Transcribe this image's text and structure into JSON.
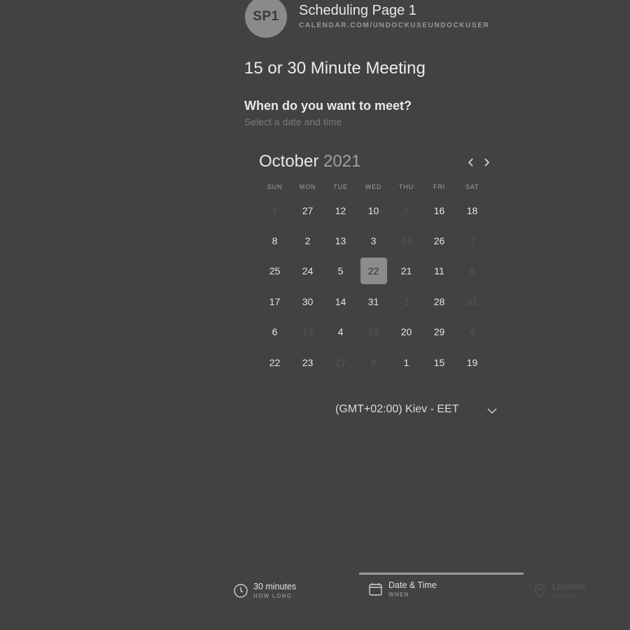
{
  "profile": {
    "initials": "SP1",
    "page_name": "Scheduling Page 1",
    "url": "CALENDAR.COM/UNDOCKUSEUNDOCKUSER"
  },
  "meeting": {
    "title": "15 or 30 Minute Meeting"
  },
  "prompt": {
    "title": "When do you want to meet?",
    "subtitle": "Select a date and time"
  },
  "calendar": {
    "month": "October",
    "year": "2021",
    "weekdays": [
      "SUN",
      "MON",
      "TUE",
      "WED",
      "THU",
      "FRI",
      "SAT"
    ],
    "weeks": [
      [
        {
          "d": "7",
          "off": true
        },
        {
          "d": "27"
        },
        {
          "d": "12"
        },
        {
          "d": "10"
        },
        {
          "d": "7",
          "off": true
        },
        {
          "d": "16"
        },
        {
          "d": "18"
        }
      ],
      [
        {
          "d": "8"
        },
        {
          "d": "2"
        },
        {
          "d": "13"
        },
        {
          "d": "3"
        },
        {
          "d": "14",
          "off": true
        },
        {
          "d": "26"
        },
        {
          "d": "7",
          "off": true
        }
      ],
      [
        {
          "d": "25"
        },
        {
          "d": "24"
        },
        {
          "d": "5"
        },
        {
          "d": "22",
          "selected": true
        },
        {
          "d": "21"
        },
        {
          "d": "11"
        },
        {
          "d": "6",
          "off": true
        }
      ],
      [
        {
          "d": "17"
        },
        {
          "d": "30"
        },
        {
          "d": "14"
        },
        {
          "d": "31"
        },
        {
          "d": "3",
          "off": true
        },
        {
          "d": "28"
        },
        {
          "d": "31",
          "off": true
        }
      ],
      [
        {
          "d": "6"
        },
        {
          "d": "13",
          "off": true
        },
        {
          "d": "4"
        },
        {
          "d": "19",
          "off": true
        },
        {
          "d": "20"
        },
        {
          "d": "29"
        },
        {
          "d": "4",
          "off": true
        }
      ],
      [
        {
          "d": "22"
        },
        {
          "d": "23"
        },
        {
          "d": "27",
          "off": true
        },
        {
          "d": "8",
          "off": true
        },
        {
          "d": "1"
        },
        {
          "d": "15"
        },
        {
          "d": "19"
        }
      ]
    ]
  },
  "timezone": {
    "label": "(GMT+02:00) Kiev - EET"
  },
  "steps": [
    {
      "title": "30 minutes",
      "sub": "HOW LONG",
      "icon": "clock-icon",
      "active": false,
      "dim": false
    },
    {
      "title": "Date & Time",
      "sub": "WHEN",
      "icon": "calendar-icon",
      "active": true,
      "dim": false
    },
    {
      "title": "Location",
      "sub": "WHERE",
      "icon": "location-pin-icon",
      "active": false,
      "dim": true
    }
  ],
  "colors": {
    "background": "#424242",
    "selected_day": "#8c8c8c",
    "avatar": "#8a8a8a"
  }
}
